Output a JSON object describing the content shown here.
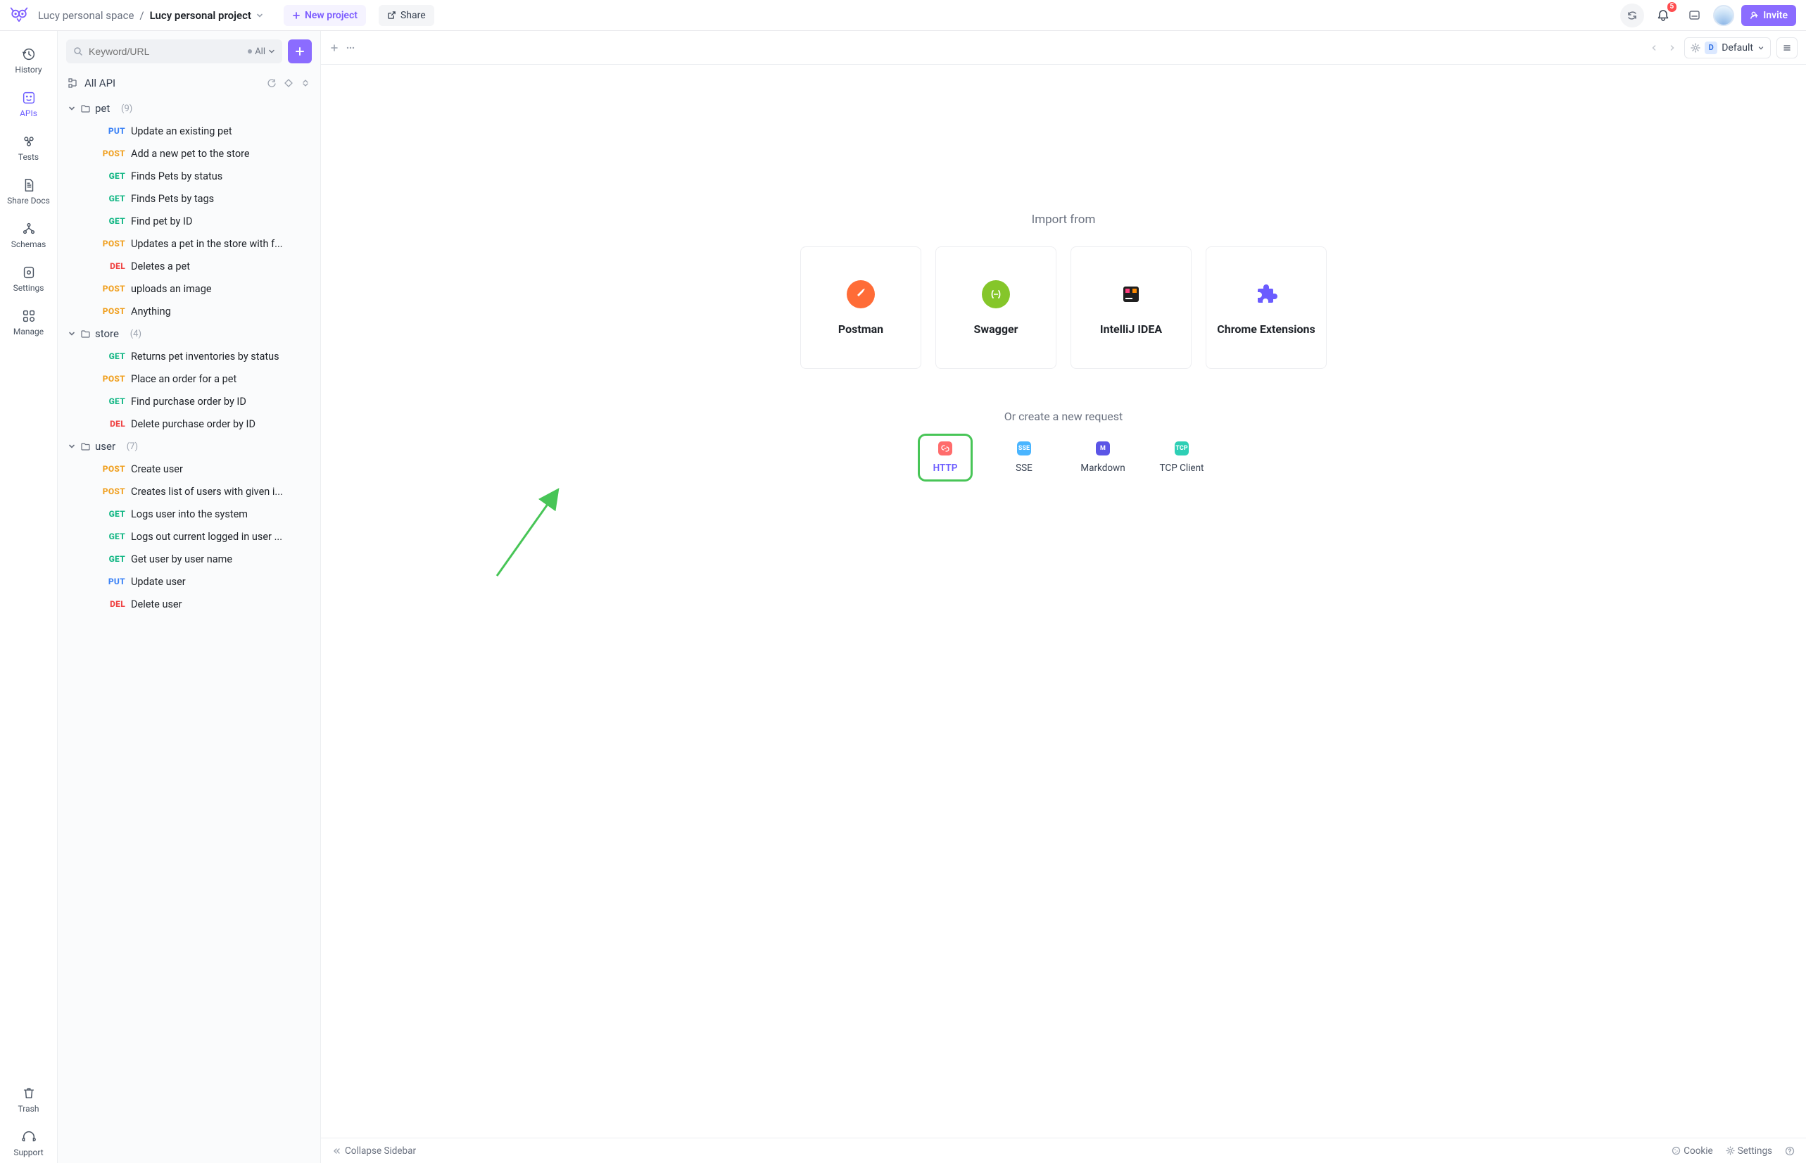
{
  "header": {
    "workspace": "Lucy personal space",
    "project": "Lucy personal project",
    "new_project": "New project",
    "share": "Share",
    "invite": "Invite",
    "notif_count": "5",
    "env_letter": "D",
    "env_name": "Default"
  },
  "rail": {
    "history": "History",
    "apis": "APIs",
    "tests": "Tests",
    "share_docs": "Share Docs",
    "schemas": "Schemas",
    "settings": "Settings",
    "manage": "Manage",
    "trash": "Trash",
    "support": "Support"
  },
  "sidebar": {
    "search_placeholder": "Keyword/URL",
    "search_filter": "All",
    "root_title": "All API",
    "folders": [
      {
        "name": "pet",
        "count": "(9)",
        "apis": [
          {
            "method": "PUT",
            "name": "Update an existing pet"
          },
          {
            "method": "POST",
            "name": "Add a new pet to the store"
          },
          {
            "method": "GET",
            "name": "Finds Pets by status"
          },
          {
            "method": "GET",
            "name": "Finds Pets by tags"
          },
          {
            "method": "GET",
            "name": "Find pet by ID"
          },
          {
            "method": "POST",
            "name": "Updates a pet in the store with f..."
          },
          {
            "method": "DEL",
            "name": "Deletes a pet"
          },
          {
            "method": "POST",
            "name": "uploads an image"
          },
          {
            "method": "POST",
            "name": "Anything"
          }
        ]
      },
      {
        "name": "store",
        "count": "(4)",
        "apis": [
          {
            "method": "GET",
            "name": "Returns pet inventories by status"
          },
          {
            "method": "POST",
            "name": "Place an order for a pet"
          },
          {
            "method": "GET",
            "name": "Find purchase order by ID"
          },
          {
            "method": "DEL",
            "name": "Delete purchase order by ID"
          }
        ]
      },
      {
        "name": "user",
        "count": "(7)",
        "apis": [
          {
            "method": "POST",
            "name": "Create user"
          },
          {
            "method": "POST",
            "name": "Creates list of users with given i..."
          },
          {
            "method": "GET",
            "name": "Logs user into the system"
          },
          {
            "method": "GET",
            "name": "Logs out current logged in user ..."
          },
          {
            "method": "GET",
            "name": "Get user by user name"
          },
          {
            "method": "PUT",
            "name": "Update user"
          },
          {
            "method": "DEL",
            "name": "Delete user"
          }
        ]
      }
    ]
  },
  "main": {
    "import_title": "Import from",
    "cards": [
      {
        "label": "Postman"
      },
      {
        "label": "Swagger"
      },
      {
        "label": "IntelliJ IDEA"
      },
      {
        "label": "Chrome Extensions"
      }
    ],
    "create_title": "Or create a new request",
    "chips": [
      {
        "label": "HTTP"
      },
      {
        "label": "SSE"
      },
      {
        "label": "Markdown"
      },
      {
        "label": "TCP Client"
      }
    ]
  },
  "footer": {
    "collapse": "Collapse Sidebar",
    "cookie": "Cookie",
    "settings": "Settings"
  }
}
